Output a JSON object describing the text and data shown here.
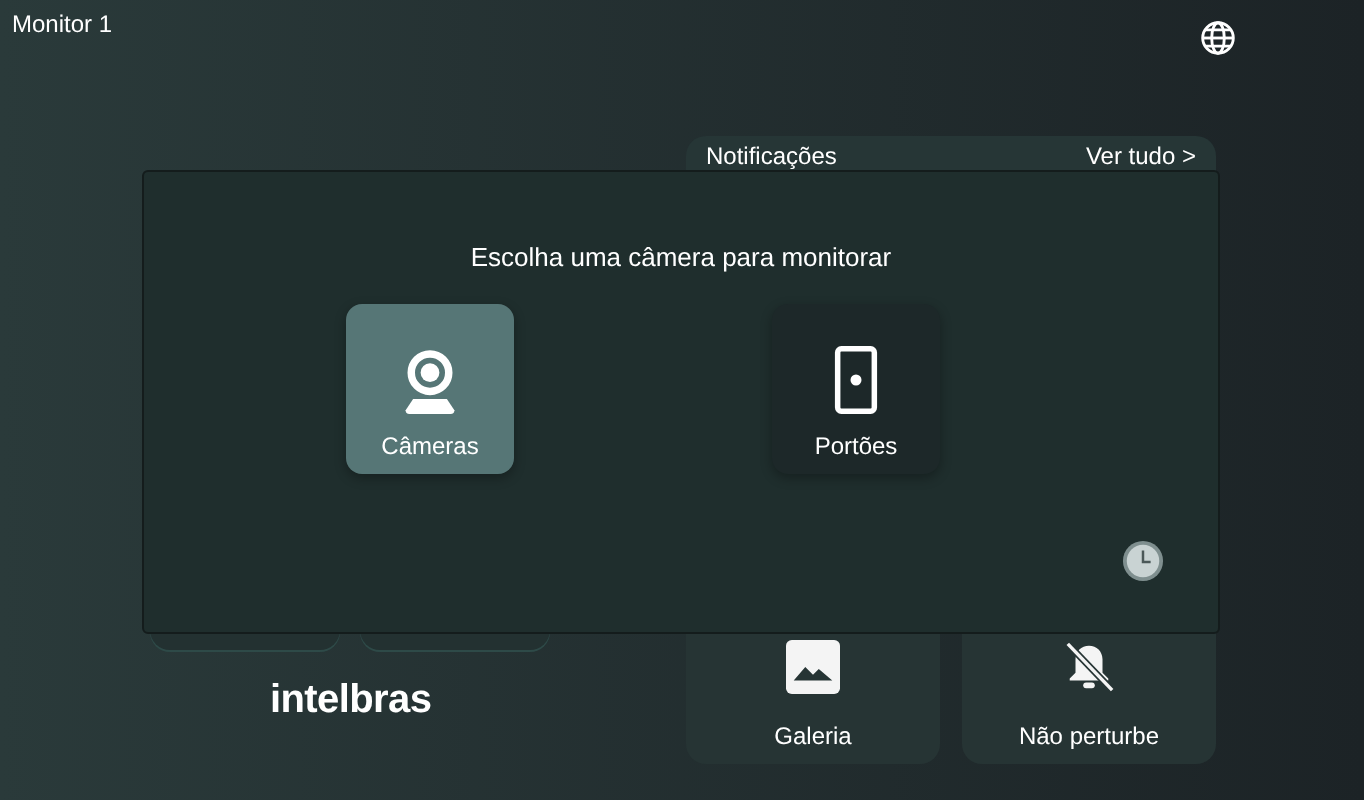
{
  "header": {
    "title": "Monitor 1"
  },
  "notifications": {
    "title": "Notificações",
    "link": "Ver tudo >"
  },
  "tiles": [
    {
      "label": "Galeria",
      "kind": "gallery"
    },
    {
      "label": "Não perturbe",
      "kind": "dnd"
    }
  ],
  "logo": "intelbras",
  "dialog": {
    "title": "Escolha uma câmera para monitorar",
    "options": [
      {
        "label": "Câmeras",
        "kind": "camera",
        "selected": true
      },
      {
        "label": "Portões",
        "kind": "gate",
        "selected": false
      }
    ]
  }
}
